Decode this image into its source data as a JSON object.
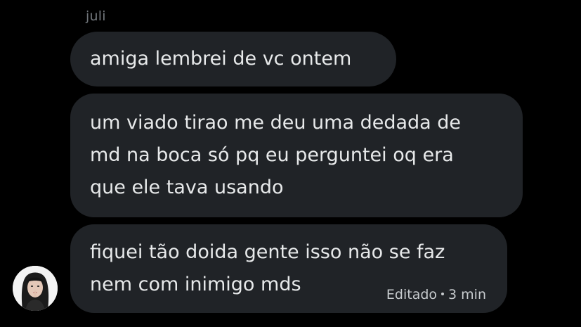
{
  "sender": "juli",
  "messages": [
    {
      "lines": [
        "amiga lembrei de vc ontem"
      ]
    },
    {
      "lines": [
        "um viado tirao me deu uma dedada de",
        "md na boca só pq eu perguntei oq era",
        "que ele tava usando"
      ]
    },
    {
      "lines": [
        "fiquei tão doida gente isso não se faz",
        "nem com inimigo mds"
      ]
    }
  ],
  "meta": {
    "edited": "Editado",
    "time": "3 min"
  },
  "colors": {
    "background": "#000000",
    "bubble": "#202327",
    "text": "#e7e9ea",
    "muted": "#71767b"
  }
}
